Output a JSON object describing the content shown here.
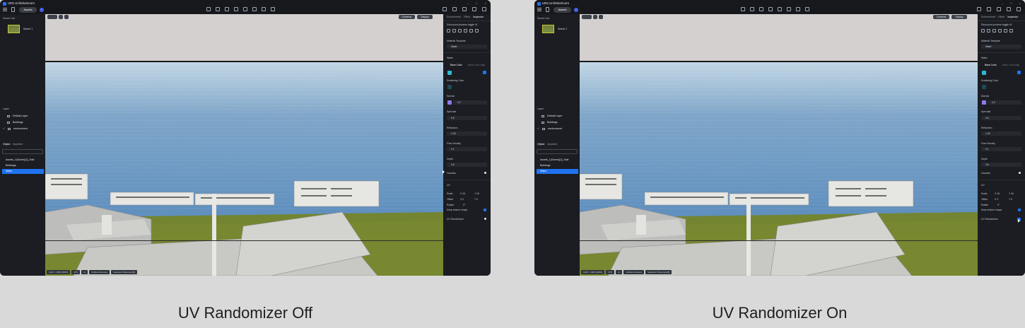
{
  "app": {
    "title": "UE5 Unlimbotroom",
    "assets_label": "Assets",
    "window_controls": [
      "–",
      "□",
      "×"
    ],
    "toolbar_icons": [
      "sun-icon",
      "measure-icon",
      "brush-icon",
      "cube-icon",
      "folder-icon",
      "grid-icon",
      "tree-icon",
      "car-icon"
    ],
    "right_icons": [
      "camera-icon",
      "image-icon",
      "video-icon",
      "upload-icon",
      "export-icon"
    ]
  },
  "scene_panel": {
    "header": "Scene List",
    "scene_name": "Scene 1"
  },
  "layer_panel": {
    "header": "Layer",
    "items": [
      "Default Layer",
      "Buildings",
      "environment"
    ]
  },
  "object_panel": {
    "tabs": [
      "Object",
      "Imported"
    ],
    "items": [
      "Assets_1(Scene)[1]_Sale",
      "Buildings",
      "Water"
    ],
    "selected_index": 2
  },
  "viewport": {
    "buttons": [
      "Cameras",
      "Display"
    ],
    "status": [
      "1920 × 1080 (100%)",
      "FPS",
      "Lit",
      "Collision/Camera",
      "Selected: Placement(8)"
    ]
  },
  "inspector": {
    "tabs": [
      "Environment",
      "Effect",
      "Inspector"
    ],
    "tagline": "Show post-process toggle UI",
    "material_template_label": "Material Template",
    "material_template_value": "Water",
    "water_section": "Water",
    "base_color_tabs": [
      "Base Color",
      "Base Color Map"
    ],
    "scattering_label": "Scattering Color",
    "normal_label": "Normal",
    "normal_value": "0.2",
    "specular_label": "Specular",
    "specular_value": "0.6",
    "refraction_label": "Refraction",
    "refraction_value": "1.33",
    "flow_velocity_label": "Flow Velocity",
    "flow_velocity_value": "0.1",
    "depth_label": "Depth",
    "depth_value": "0.8",
    "caustics_label": "Caustics",
    "uv_section": "UV",
    "uv_rows": [
      "Scale",
      "Offset",
      "Rotate"
    ],
    "uv_scale_x": "X 26",
    "uv_scale_y": "Y 26",
    "uv_offset_x": "X 0",
    "uv_offset_y": "Y 0",
    "uv_rotate": "0°",
    "keep_texture_label": "Keep texture shape",
    "uv_randomizer_label": "UV Randomizer"
  },
  "colors": {
    "accent": "#1f73f0",
    "base_color": "#2fb8d4",
    "normal_color": "#8a7df0",
    "scattering_color": "#1c4b57"
  },
  "captions": {
    "left": "UV Randomizer Off",
    "right": "UV Randomizer On"
  }
}
